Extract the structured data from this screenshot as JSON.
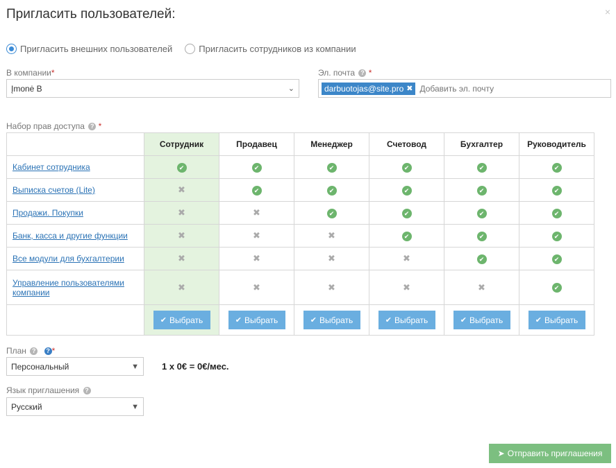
{
  "dialog": {
    "title": "Пригласить пользователей:",
    "close_icon": "×"
  },
  "invite_type": {
    "options": [
      {
        "label": "Пригласить внешних пользователей",
        "checked": true
      },
      {
        "label": "Пригласить сотрудников из компании",
        "checked": false
      }
    ]
  },
  "company": {
    "label": "В компании",
    "required": "*",
    "value": "Įmonė B"
  },
  "email": {
    "label": "Эл. почта",
    "required": "*",
    "tags": [
      "darbuotojas@site.pro"
    ],
    "placeholder": "Добавить эл. почту"
  },
  "permissions": {
    "label": "Набор прав доступа",
    "required": "*",
    "roles": [
      "Сотрудник",
      "Продавец",
      "Менеджер",
      "Счетовод",
      "Бухгалтер",
      "Руководитель"
    ],
    "rows": [
      {
        "name": "Кабинет сотрудника",
        "access": [
          true,
          true,
          true,
          true,
          true,
          true
        ]
      },
      {
        "name": "Выписка счетов (Lite)",
        "access": [
          false,
          true,
          true,
          true,
          true,
          true
        ]
      },
      {
        "name": "Продажи. Покупки",
        "access": [
          false,
          false,
          true,
          true,
          true,
          true
        ]
      },
      {
        "name": "Банк, касса и другие функции",
        "access": [
          false,
          false,
          false,
          true,
          true,
          true
        ]
      },
      {
        "name": "Все модули для бухгалтерии",
        "access": [
          false,
          false,
          false,
          false,
          true,
          true
        ]
      },
      {
        "name": "Управление пользователями компании",
        "access": [
          false,
          false,
          false,
          false,
          false,
          true
        ]
      }
    ],
    "select_label": "Выбрать",
    "highlighted_role_index": 0
  },
  "plan": {
    "label": "План",
    "required": "*",
    "value": "Персональный",
    "price": "1 x 0€ = 0€/мес."
  },
  "language": {
    "label": "Язык приглашения",
    "value": "Русский"
  },
  "send_button": {
    "label": "Отправить приглашения"
  },
  "colors": {
    "accent": "#3a8ad6",
    "highlight_column": "#e4f3df",
    "check_green": "#6db56d",
    "select_button": "#6aaee0",
    "send_button": "#7cbf80"
  },
  "icons": {
    "check": "check-circle-icon",
    "deny": "cross-icon",
    "help": "question-circle-icon",
    "send": "paper-plane-icon"
  }
}
